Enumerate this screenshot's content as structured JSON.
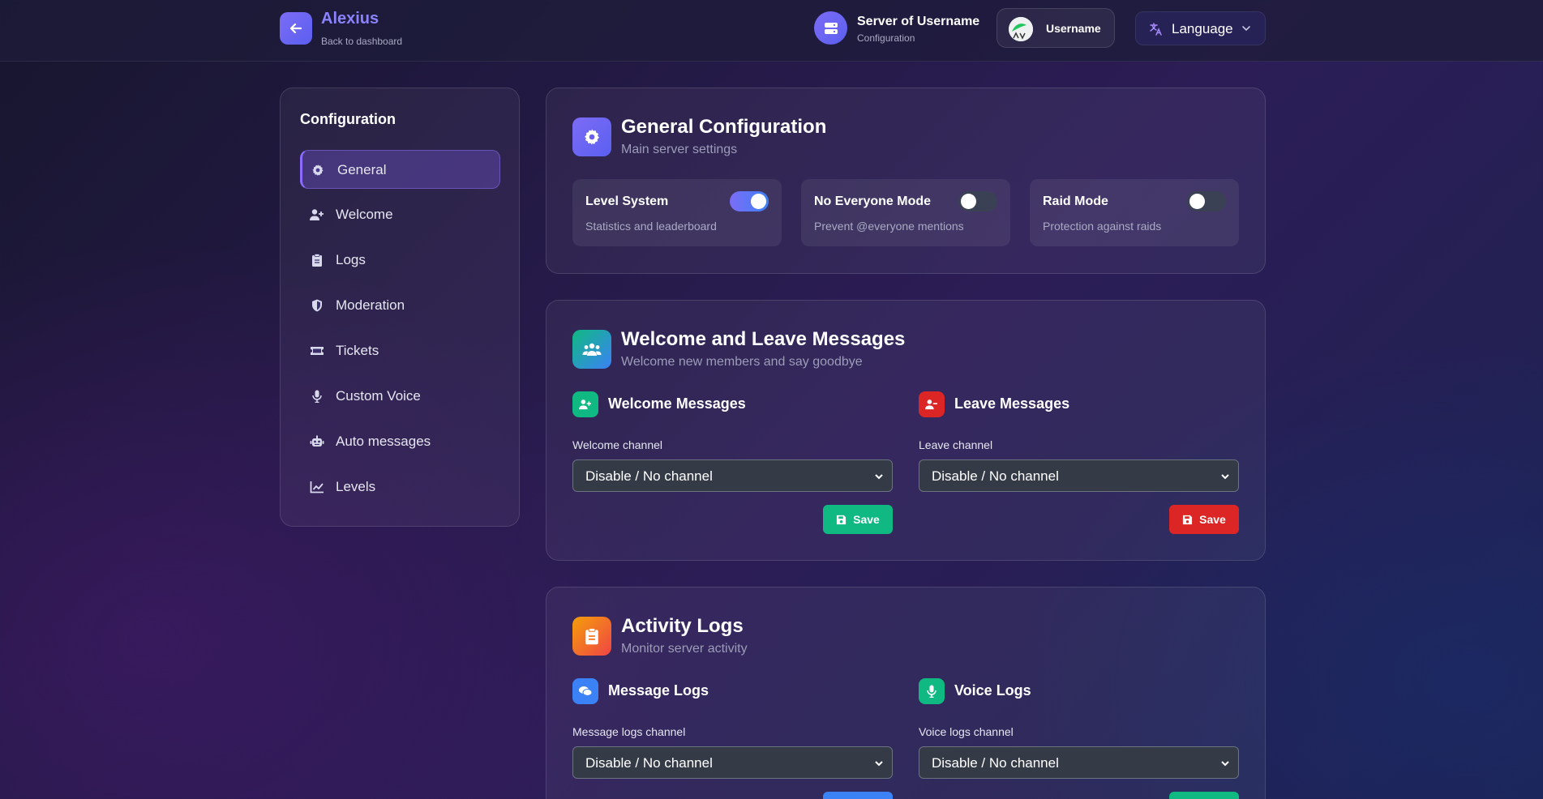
{
  "header": {
    "brand_name": "Alexius",
    "brand_sub": "Back to dashboard",
    "server_name": "Server of Username",
    "server_sub": "Configuration",
    "username": "Username",
    "language_label": "Language"
  },
  "sidebar": {
    "title": "Configuration",
    "items": [
      {
        "label": "General",
        "icon": "gear-icon",
        "active": true
      },
      {
        "label": "Welcome",
        "icon": "user-plus-icon"
      },
      {
        "label": "Logs",
        "icon": "clipboard-icon"
      },
      {
        "label": "Moderation",
        "icon": "shield-icon"
      },
      {
        "label": "Tickets",
        "icon": "ticket-icon"
      },
      {
        "label": "Custom Voice",
        "icon": "microphone-icon"
      },
      {
        "label": "Auto messages",
        "icon": "robot-icon"
      },
      {
        "label": "Levels",
        "icon": "chart-line-icon"
      }
    ]
  },
  "general": {
    "title": "General Configuration",
    "subtitle": "Main server settings",
    "toggles": [
      {
        "title": "Level System",
        "desc": "Statistics and leaderboard",
        "on": true
      },
      {
        "title": "No Everyone Mode",
        "desc": "Prevent @everyone mentions",
        "on": false
      },
      {
        "title": "Raid Mode",
        "desc": "Protection against raids",
        "on": false
      }
    ]
  },
  "welcome": {
    "title": "Welcome and Leave Messages",
    "subtitle": "Welcome new members and say goodbye",
    "welcome_title": "Welcome Messages",
    "welcome_label": "Welcome channel",
    "welcome_value": "Disable / No channel",
    "leave_title": "Leave Messages",
    "leave_label": "Leave channel",
    "leave_value": "Disable / No channel",
    "save_label": "Save"
  },
  "logs": {
    "title": "Activity Logs",
    "subtitle": "Monitor server activity",
    "message_title": "Message Logs",
    "message_label": "Message logs channel",
    "message_value": "Disable / No channel",
    "voice_title": "Voice Logs",
    "voice_label": "Voice logs channel",
    "voice_value": "Disable / No channel"
  },
  "colors": {
    "accent": "#7c6cf6",
    "green": "#10b981",
    "red": "#dc2626",
    "blue": "#3b82f6",
    "orange": "#f97316"
  }
}
